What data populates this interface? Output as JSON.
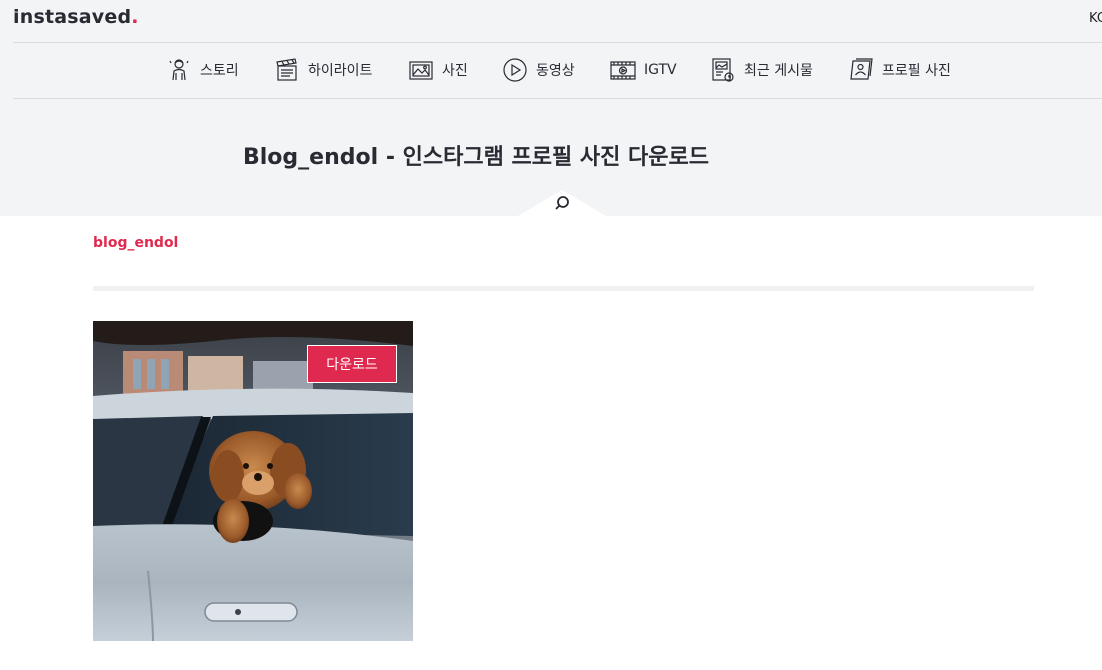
{
  "brand": {
    "name": "instasaved",
    "dot": "."
  },
  "lang": "KO",
  "nav": [
    {
      "label": "스토리",
      "icon": "story-icon"
    },
    {
      "label": "하이라이트",
      "icon": "clapperboard-icon"
    },
    {
      "label": "사진",
      "icon": "photo-icon"
    },
    {
      "label": "동영상",
      "icon": "play-icon"
    },
    {
      "label": "IGTV",
      "icon": "igtv-icon"
    },
    {
      "label": "최근 게시물",
      "icon": "recent-posts-icon"
    },
    {
      "label": "프로필 사진",
      "icon": "profile-photo-icon"
    }
  ],
  "heading": "Blog_endol - 인스타그램 프로필 사진 다운로드",
  "profile": {
    "username": "blog_endol",
    "download_label": "다운로드"
  },
  "colors": {
    "accent": "#e0294f",
    "header_bg": "#f3f4f6",
    "text": "#2a2a33"
  }
}
